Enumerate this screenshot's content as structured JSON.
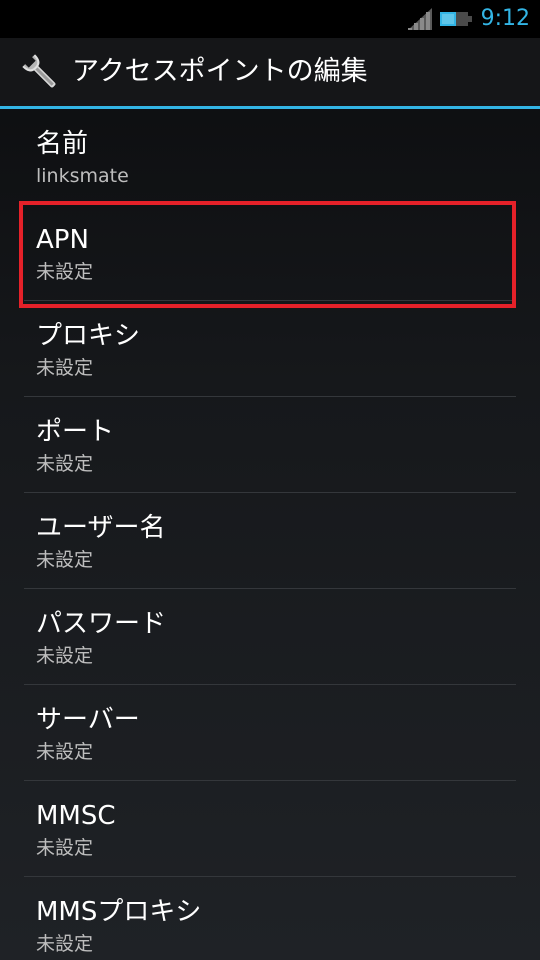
{
  "status_bar": {
    "time": "9:12",
    "signal_icon": "signal-icon",
    "battery_icon": "battery-icon",
    "accent_color": "#33b5e5"
  },
  "action_bar": {
    "icon": "wrench-icon",
    "title": "アクセスポイントの編集"
  },
  "preferences": [
    {
      "title": "名前",
      "summary": "linksmate"
    },
    {
      "title": "APN",
      "summary": "未設定",
      "highlighted": true
    },
    {
      "title": "プロキシ",
      "summary": "未設定"
    },
    {
      "title": "ポート",
      "summary": "未設定"
    },
    {
      "title": "ユーザー名",
      "summary": "未設定"
    },
    {
      "title": "パスワード",
      "summary": "未設定"
    },
    {
      "title": "サーバー",
      "summary": "未設定"
    },
    {
      "title": "MMSC",
      "summary": "未設定"
    },
    {
      "title": "MMSプロキシ",
      "summary": "未設定"
    }
  ],
  "colors": {
    "highlight": "#e52129",
    "divider": "#33b5e5"
  }
}
